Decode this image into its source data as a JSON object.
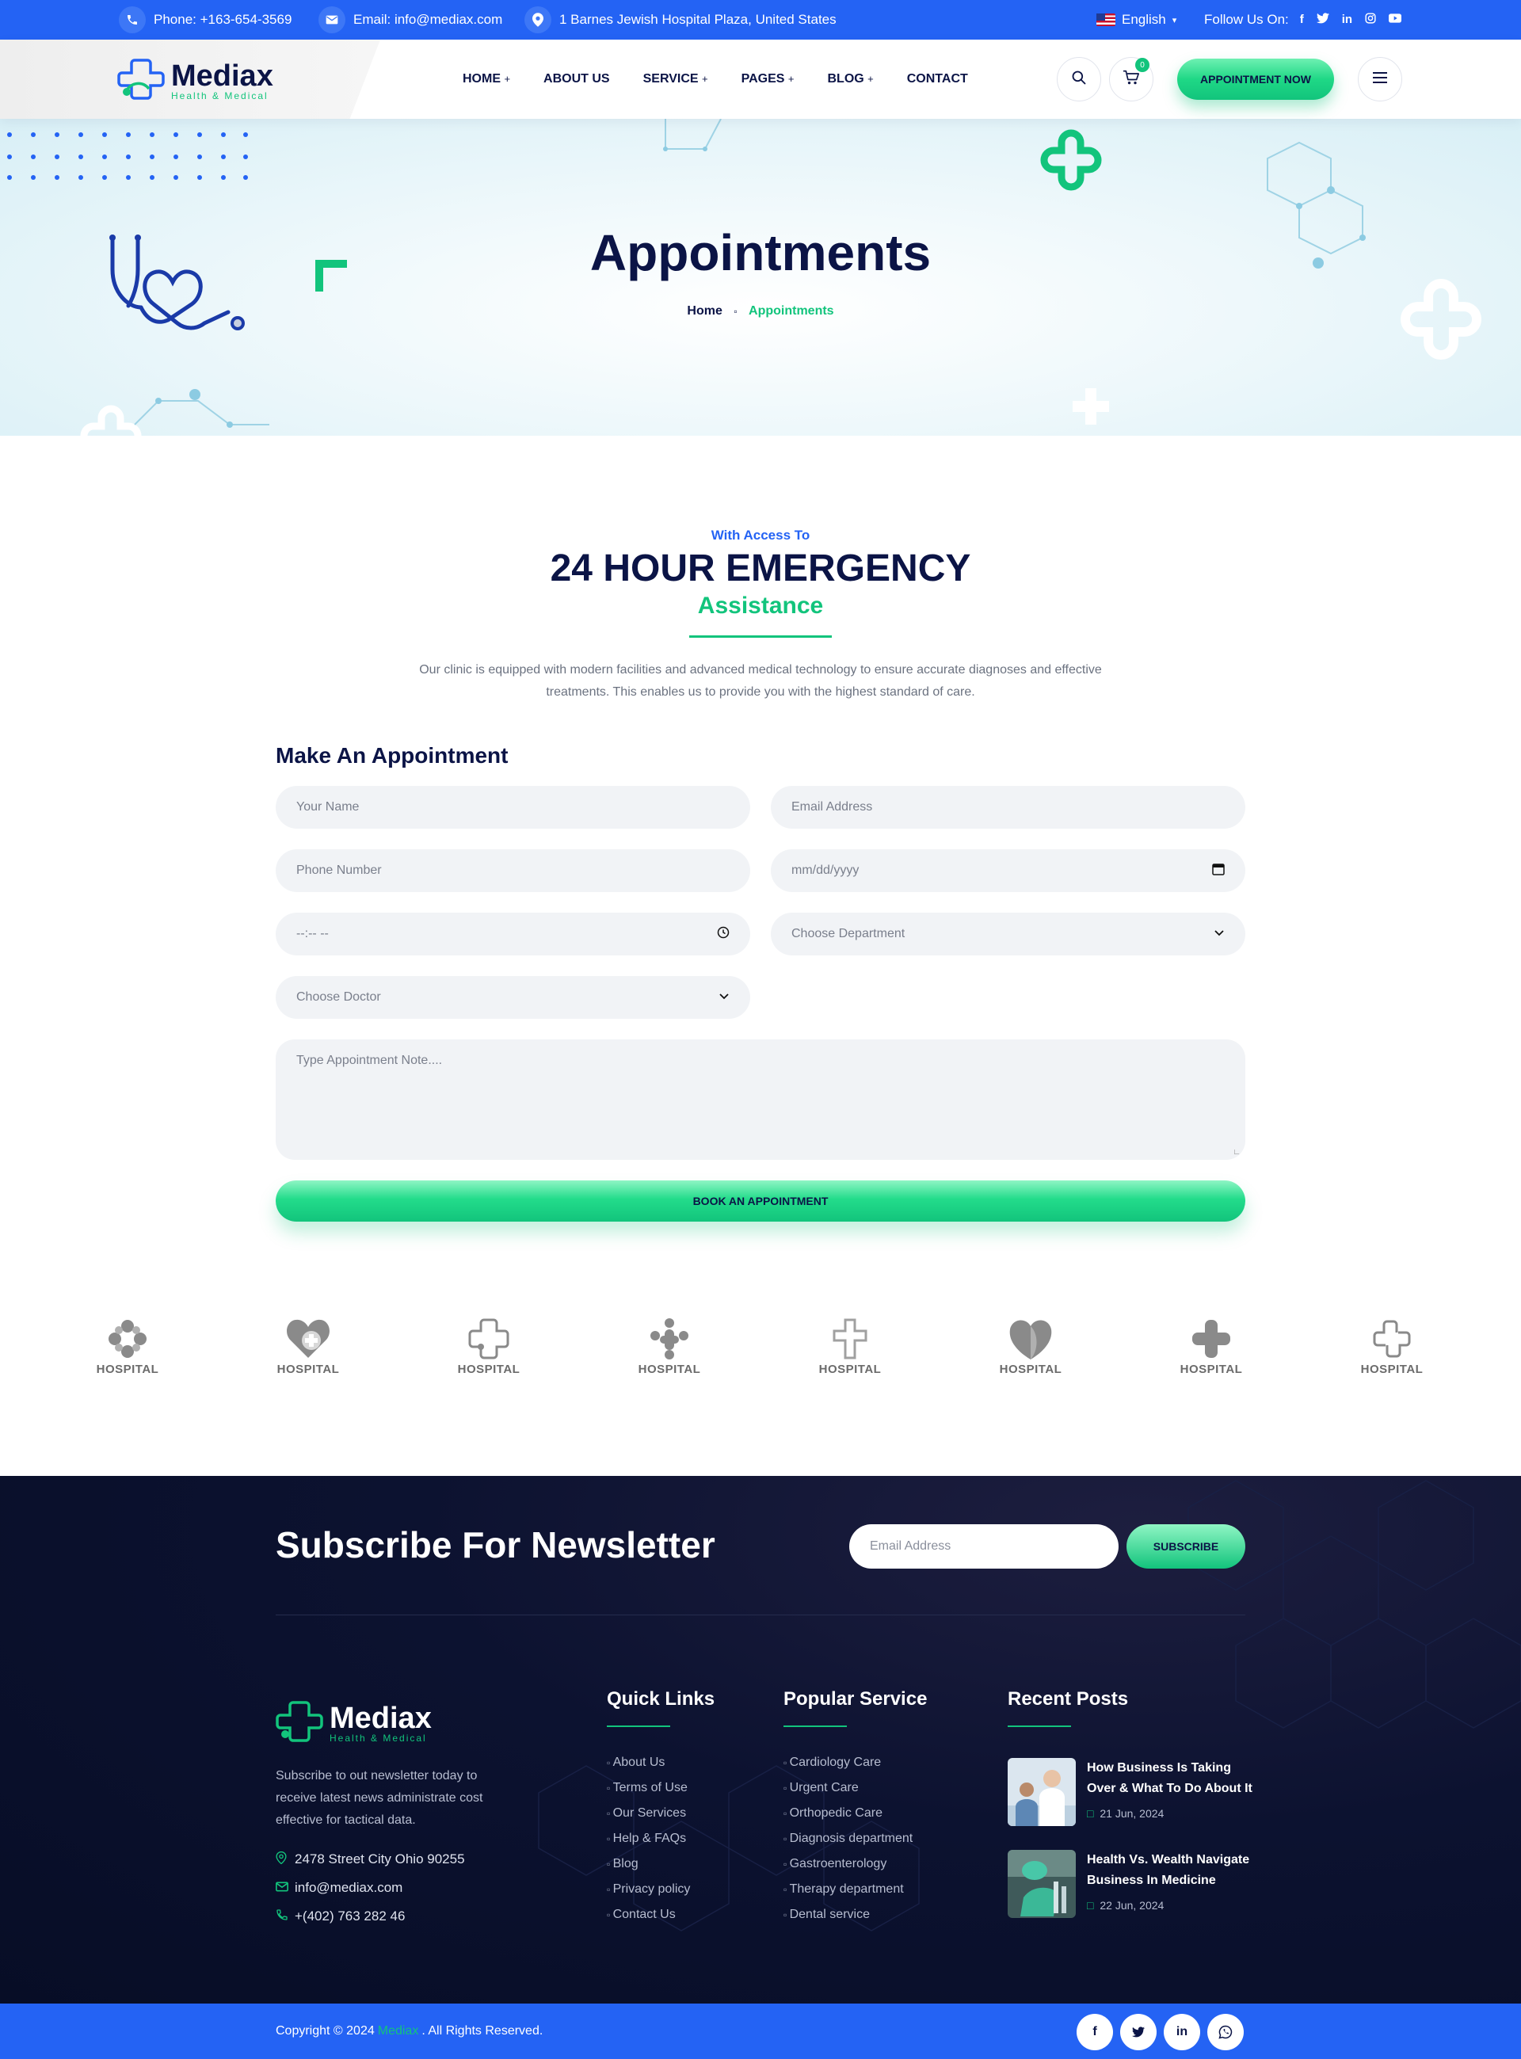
{
  "topbar": {
    "phone": "Phone: +163-654-3569",
    "email": "Email: info@mediax.com",
    "address": "1 Barnes Jewish Hospital Plaza, United States",
    "language": "English",
    "follow_label": "Follow Us On:",
    "social_icons": [
      "facebook-icon",
      "twitter-icon",
      "linkedin-icon",
      "instagram-icon",
      "youtube-icon"
    ]
  },
  "header": {
    "logo_name": "Mediax",
    "logo_tagline": "Health & Medical",
    "nav": [
      {
        "label": "HOME"
      },
      {
        "label": "ABOUT US"
      },
      {
        "label": "SERVICE"
      },
      {
        "label": "PAGES"
      },
      {
        "label": "BLOG"
      },
      {
        "label": "CONTACT"
      }
    ],
    "cart_count": "0",
    "appointment_button": "APPOINTMENT NOW"
  },
  "hero": {
    "title": "Appointments",
    "breadcrumb_home": "Home",
    "breadcrumb_current": "Appointments"
  },
  "emergency": {
    "eyebrow": "With Access To",
    "title": "24 HOUR EMERGENCY",
    "subtitle": "Assistance",
    "description_line1": "Our clinic is equipped with modern facilities and advanced medical technology to ensure accurate diagnoses and effective",
    "description_line2": "treatments. This enables us to provide you with the highest standard of care."
  },
  "form": {
    "title": "Make An Appointment",
    "name_placeholder": "Your Name",
    "email_placeholder": "Email Address",
    "phone_placeholder": "Phone Number",
    "date_placeholder": "mm/dd/yyyy",
    "time_placeholder": "--:-- --",
    "department_placeholder": "Choose Department",
    "doctor_placeholder": "Choose Doctor",
    "note_placeholder": "Type Appointment Note....",
    "submit": "BOOK AN APPOINTMENT"
  },
  "partners": [
    "HOSPITAL",
    "HOSPITAL",
    "HOSPITAL",
    "HOSPITAL",
    "HOSPITAL",
    "HOSPITAL",
    "HOSPITAL",
    "HOSPITAL"
  ],
  "newsletter": {
    "title": "Subscribe For Newsletter",
    "placeholder": "Email Address",
    "button": "SUBSCRIBE"
  },
  "footer": {
    "logo_name": "Mediax",
    "logo_tagline": "Health & Medical",
    "about_line1": "Subscribe to out newsletter today to",
    "about_line2": "receive latest news administrate cost",
    "about_line3": "effective for tactical data.",
    "address": "2478 Street City Ohio 90255",
    "email": "info@mediax.com",
    "phone": "+(402) 763 282 46",
    "quick_links_title": "Quick Links",
    "quick_links": [
      "About Us",
      "Terms of Use",
      "Our Services",
      "Help & FAQs",
      "Blog",
      "Privacy policy",
      "Contact Us"
    ],
    "services_title": "Popular Service",
    "services": [
      "Cardiology Care",
      "Urgent Care",
      "Orthopedic Care",
      "Diagnosis department",
      "Gastroenterology",
      "Therapy department",
      "Dental service"
    ],
    "posts_title": "Recent Posts",
    "posts": [
      {
        "title": "How Business Is Taking Over & What To Do About It",
        "date": "21 Jun, 2024"
      },
      {
        "title": "Health Vs. Wealth Navigate Business In Medicine",
        "date": "22 Jun, 2024"
      }
    ]
  },
  "copyright": {
    "prefix": "Copyright © 2024",
    "brand": "Mediax",
    "suffix": ". All Rights Reserved."
  },
  "colors": {
    "primary_blue": "#2463f4",
    "accent_green": "#12c47c",
    "navy": "#0b1446",
    "footer_bg": "#070d26"
  }
}
